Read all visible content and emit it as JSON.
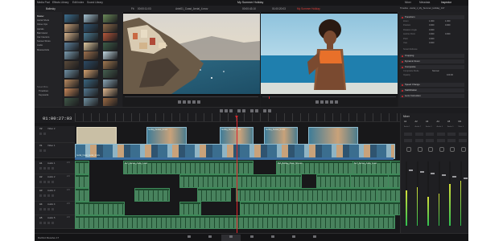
{
  "app": {
    "name": "DaVinci Resolve 17",
    "project_title": "My Summer Holiday"
  },
  "header": {
    "media_pool": "Media Pool",
    "effects": "Effects Library",
    "edit_index": "Edit Index",
    "sound_library": "Sound Library",
    "mixer": "Mixer",
    "metadata": "Metadata",
    "inspector": "Inspector"
  },
  "toolbar": {
    "bin_name": "Balinsky",
    "source_tc": "00:00:11:03",
    "source_clip": "Ariel01_Coast_Aerial_4.mov",
    "fit_label": "Fit",
    "record_tc": "00:00:43:10",
    "record_clip": "My Summer Holiday",
    "timeline_tc": "01:00:20:03",
    "inspector_clip": "Timeline - Aerial_1_My_Summer_Holiday_017"
  },
  "media_pool": {
    "bins": [
      "Master",
      "Aerial Shots",
      "Close Ups",
      "Aerials",
      "Bali Island",
      "Car Interiors",
      "Sunset Shots",
      "Audio",
      "Musical Hits"
    ],
    "smart_bins_label": "Smart Bins",
    "smart_bins": [
      "Timelines",
      "Keywords"
    ],
    "thumb_colors": [
      "#3b6e8f",
      "#a5c4d4",
      "#6b8a5a",
      "#c9a27a",
      "#2f5470",
      "#8e6b4a",
      "#d6b38c",
      "#4a7a92",
      "#b5573a",
      "#5c7f9a",
      "#e0c9a0",
      "#3d5d48",
      "#7a9cb0",
      "#9c6f4c",
      "#c0d6e0",
      "#5a4a3a",
      "#2c4a64",
      "#a07850",
      "#6f8fa3",
      "#d2a070",
      "#466050",
      "#b88a60",
      "#3a6680",
      "#8aa4b4",
      "#c8885a",
      "#547890",
      "#e0b890",
      "#405848",
      "#7090a0",
      "#9a6a44"
    ]
  },
  "inspector": {
    "sections": [
      "Transform",
      "Cropping",
      "Dynamic Zoom",
      "Composite",
      "Speed Change",
      "Stabilization",
      "Lens Correction"
    ],
    "transform_rows": [
      {
        "label": "Zoom",
        "x": "1.000",
        "y": "1.000"
      },
      {
        "label": "Position",
        "x": "0.000",
        "y": "0.000"
      },
      {
        "label": "Rotation Angle",
        "x": "0.000",
        "y": ""
      },
      {
        "label": "Anchor Point",
        "x": "0.000",
        "y": "0.000"
      },
      {
        "label": "Pitch",
        "x": "0.000",
        "y": ""
      },
      {
        "label": "Yaw",
        "x": "0.000",
        "y": ""
      }
    ],
    "smart_reframe": "Smart Reframe",
    "composite_mode_label": "Composite Mode",
    "composite_mode_value": "Normal",
    "opacity_label": "Opacity",
    "opacity_value": "100.00"
  },
  "timeline": {
    "timecode": "01:00:27:03",
    "video_tracks": [
      {
        "id": "V2",
        "name": "Video 2"
      },
      {
        "id": "V1",
        "name": "Video 1"
      }
    ],
    "audio_tracks": [
      {
        "id": "A1",
        "name": "Audio 1",
        "level": "2.0"
      },
      {
        "id": "A2",
        "name": "Audio 2",
        "level": "2.0"
      },
      {
        "id": "A3",
        "name": "Audio 3",
        "level": "2.0"
      },
      {
        "id": "A4",
        "name": "Audio 4",
        "level": "2.0"
      },
      {
        "id": "A5",
        "name": "Audio 5",
        "level": "2.0"
      }
    ],
    "v2_clips": [
      "Surfing_Sunset_4.mov",
      "Surfing_Sunset_2.mov",
      "Surfing_Sunset_5.mov"
    ],
    "v1_label": "Aerial_Coast_Aerial_4.mov",
    "a1_labels": [
      "Surf_Sunset_Audio_1.wav",
      "Bali_Holiday_Music_Mix.wav",
      "Surf_Sunset_Audio_2.wav"
    ]
  },
  "mixer": {
    "title": "Mixer",
    "channels": [
      "A1",
      "A2",
      "A3",
      "A4",
      "A5",
      "M1"
    ],
    "channel_names": [
      "Audio 1",
      "Audio 2",
      "Audio 3",
      "Audio 4",
      "Audio 5",
      "Main 1"
    ],
    "meter_levels": [
      0.55,
      0.6,
      0.45,
      0.5,
      0.65,
      0.7
    ]
  },
  "pages": {
    "items": [
      "Media",
      "Cut",
      "Edit",
      "Fusion",
      "Color",
      "Fairlight",
      "Deliver"
    ],
    "active": "Edit"
  },
  "colors": {
    "accent_red": "#e0262c",
    "audio_green": "#3f8a5a",
    "video_blue": "#8fbcd0"
  }
}
